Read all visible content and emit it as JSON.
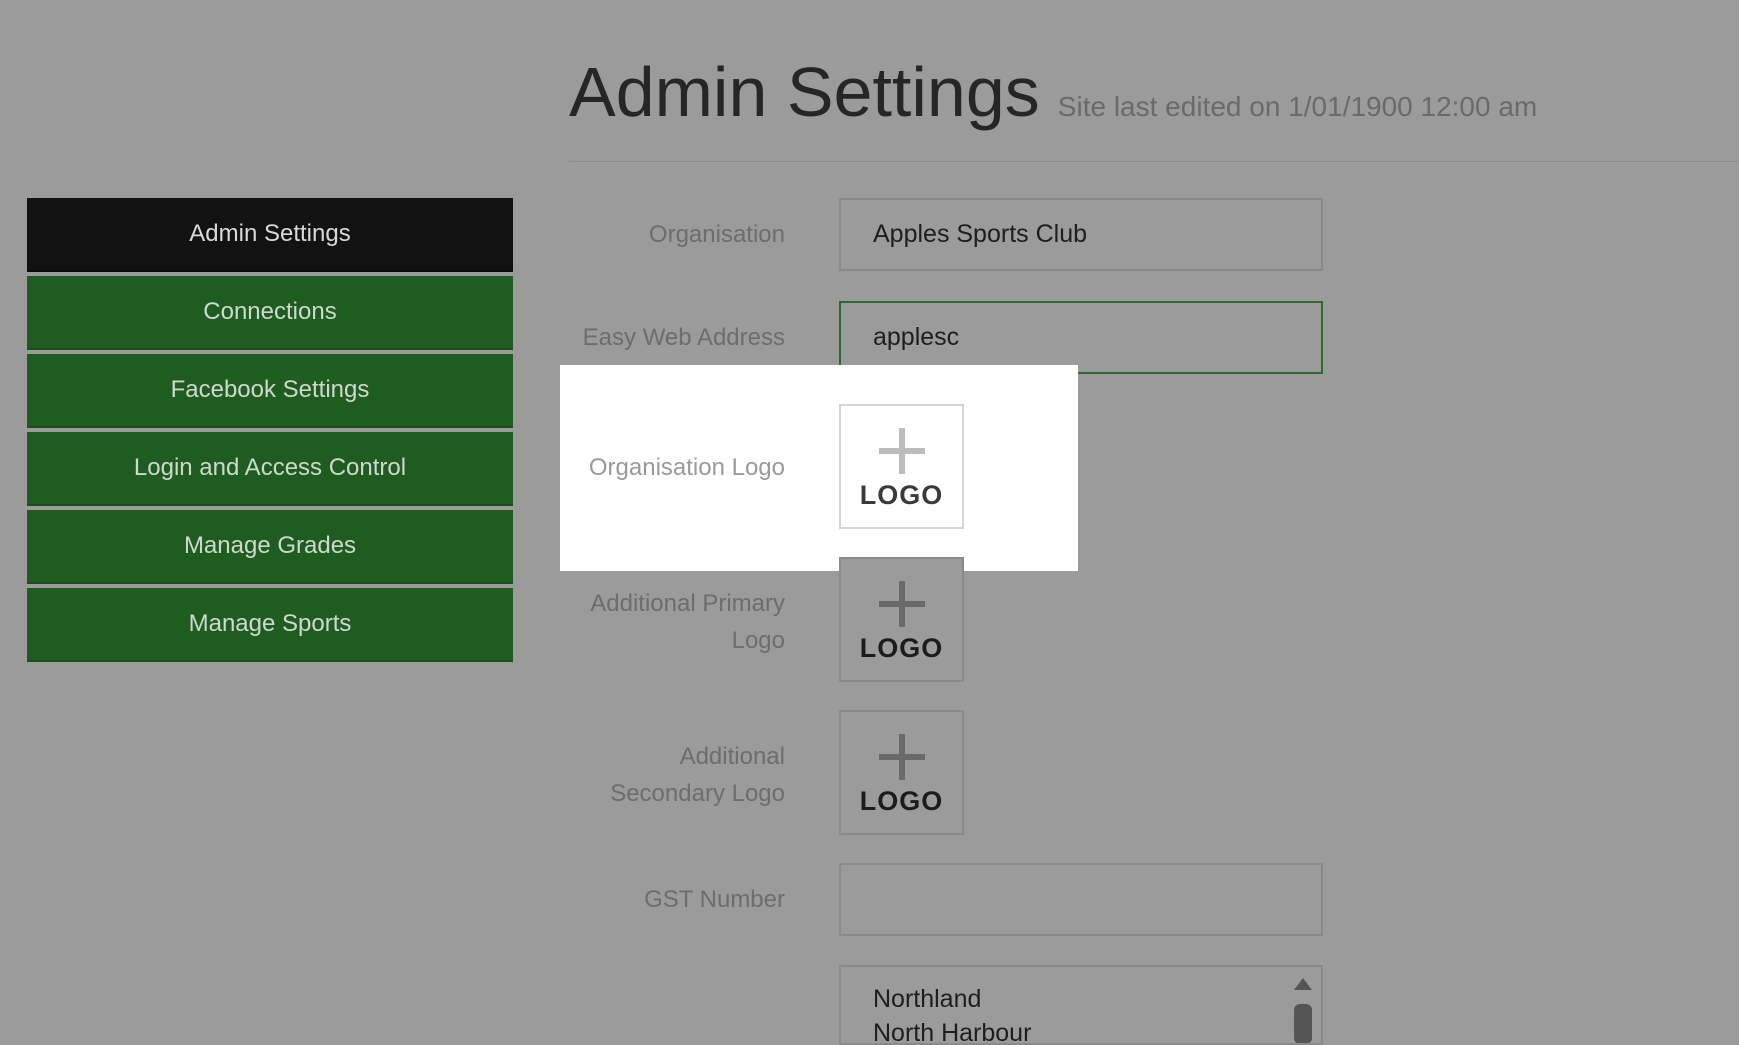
{
  "header": {
    "title": "Admin Settings",
    "subtitle": "Site last edited on 1/01/1900 12:00 am"
  },
  "sidebar": {
    "items": [
      {
        "label": "Admin Settings",
        "active": true
      },
      {
        "label": "Connections"
      },
      {
        "label": "Facebook Settings"
      },
      {
        "label": "Login and Access Control"
      },
      {
        "label": "Manage Grades"
      },
      {
        "label": "Manage Sports"
      }
    ]
  },
  "form": {
    "organisation": {
      "label": "Organisation",
      "value": "Apples Sports Club"
    },
    "web_address": {
      "label": "Easy Web Address",
      "value": "applesc"
    },
    "org_logo": {
      "label": "Organisation Logo",
      "button_text": "LOGO"
    },
    "primary_logo": {
      "label": "Additional Primary Logo",
      "button_text": "LOGO"
    },
    "secondary_logo": {
      "label": "Additional Secondary Logo",
      "button_text": "LOGO"
    },
    "gst": {
      "label": "GST Number",
      "value": ""
    },
    "regions": {
      "items": [
        "Northland",
        "North Harbour"
      ]
    }
  },
  "colors": {
    "sidebar_active": "#121212",
    "sidebar_item": "#1f5c20",
    "focus_border": "#2c6b2d",
    "overlay": "#9b9b9b"
  },
  "icons": {
    "logo_placeholder": "plus-icon"
  }
}
